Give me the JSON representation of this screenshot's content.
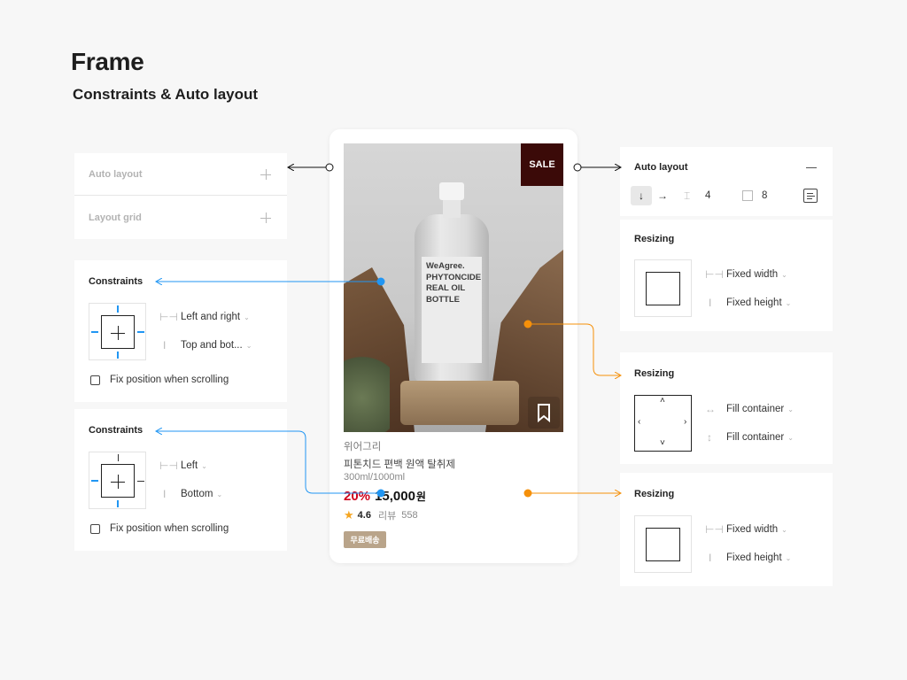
{
  "header": {
    "title": "Frame",
    "subtitle": "Constraints & Auto layout"
  },
  "left_panel": {
    "auto_layout_label": "Auto layout",
    "layout_grid_label": "Layout grid"
  },
  "constraints_1": {
    "title": "Constraints",
    "horizontal_label": "Left and right",
    "vertical_label": "Top and bot...",
    "checkbox_label": "Fix position when scrolling"
  },
  "constraints_2": {
    "title": "Constraints",
    "horizontal_label": "Left",
    "vertical_label": "Bottom",
    "checkbox_label": "Fix position when scrolling"
  },
  "product_card": {
    "sale_label": "SALE",
    "bottle_text": "WeAgree.\nPHYTONCIDE\nREAL OIL\nBOTTLE",
    "brand": "위어그리",
    "name": "피톤치드 편백 원액 탈취제",
    "volume": "300ml/1000ml",
    "discount": "20%",
    "price": "15,000",
    "currency": "원",
    "rating": "4.6",
    "review_label": "리뷰",
    "review_count": "558",
    "shipping_badge": "무료배송"
  },
  "auto_layout_panel": {
    "title": "Auto layout",
    "spacing_value": "4",
    "padding_value": "8"
  },
  "resizing_1": {
    "title": "Resizing",
    "width_label": "Fixed width",
    "height_label": "Fixed height"
  },
  "resizing_2": {
    "title": "Resizing",
    "width_label": "Fill container",
    "height_label": "Fill container"
  },
  "resizing_3": {
    "title": "Resizing",
    "width_label": "Fixed width",
    "height_label": "Fixed height"
  },
  "colors": {
    "constraint_blue": "#2196f3",
    "resize_orange": "#f5900a",
    "sale_bg": "#3b0a08",
    "discount_red": "#d0021b",
    "star": "#f5a623",
    "badge": "#b9a48a"
  }
}
